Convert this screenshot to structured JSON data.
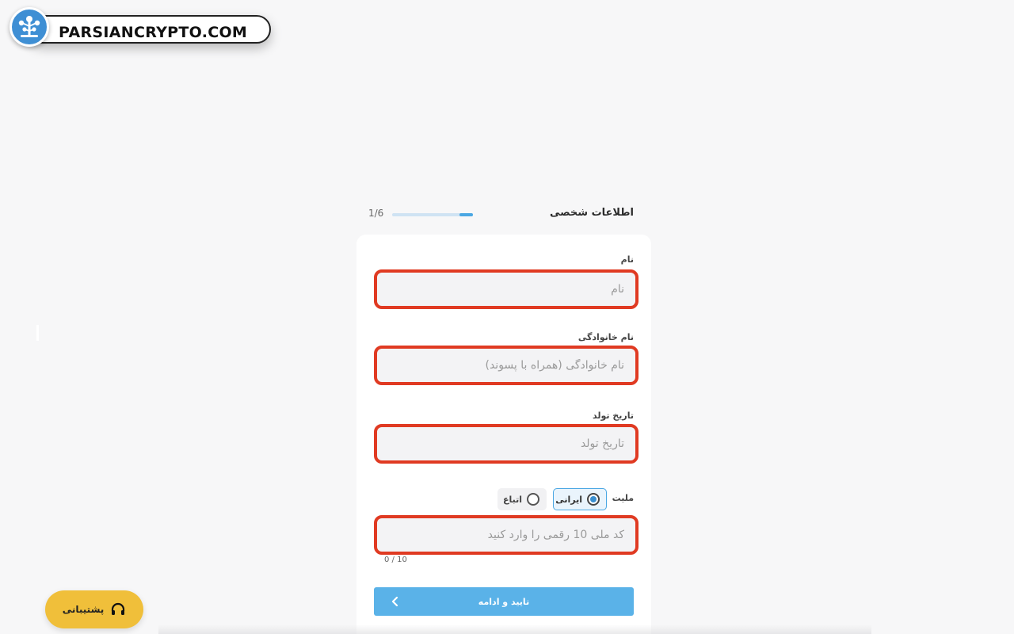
{
  "watermark": {
    "text": "PARSIANCRYPTO.COM"
  },
  "header": {
    "title": "اطلاعات شخصی",
    "step_text": "1/6",
    "progress_fraction": 0.167
  },
  "form": {
    "first_name": {
      "label": "نام",
      "placeholder": "نام",
      "value": ""
    },
    "last_name": {
      "label": "نام خانوادگی",
      "placeholder": "نام خانوادگی (همراه با پسوند)",
      "value": ""
    },
    "birth_date": {
      "label": "تاریخ تولد",
      "placeholder": "تاریخ تولد",
      "value": ""
    },
    "nationality": {
      "label": "ملیت",
      "options": [
        {
          "label": "ایرانی",
          "selected": true
        },
        {
          "label": "اتباع",
          "selected": false
        }
      ]
    },
    "national_code": {
      "placeholder": "کد ملی 10 رقمی را وارد کنید",
      "value": "",
      "counter": "0 / 10"
    },
    "submit_label": "تایید و ادامه"
  },
  "support": {
    "label": "پشتیبانی"
  },
  "colors": {
    "accent": "#4aa7e3",
    "highlight_border": "#e03a22",
    "support_button": "#f0bf3a",
    "submit_button": "#5ab2e8"
  }
}
